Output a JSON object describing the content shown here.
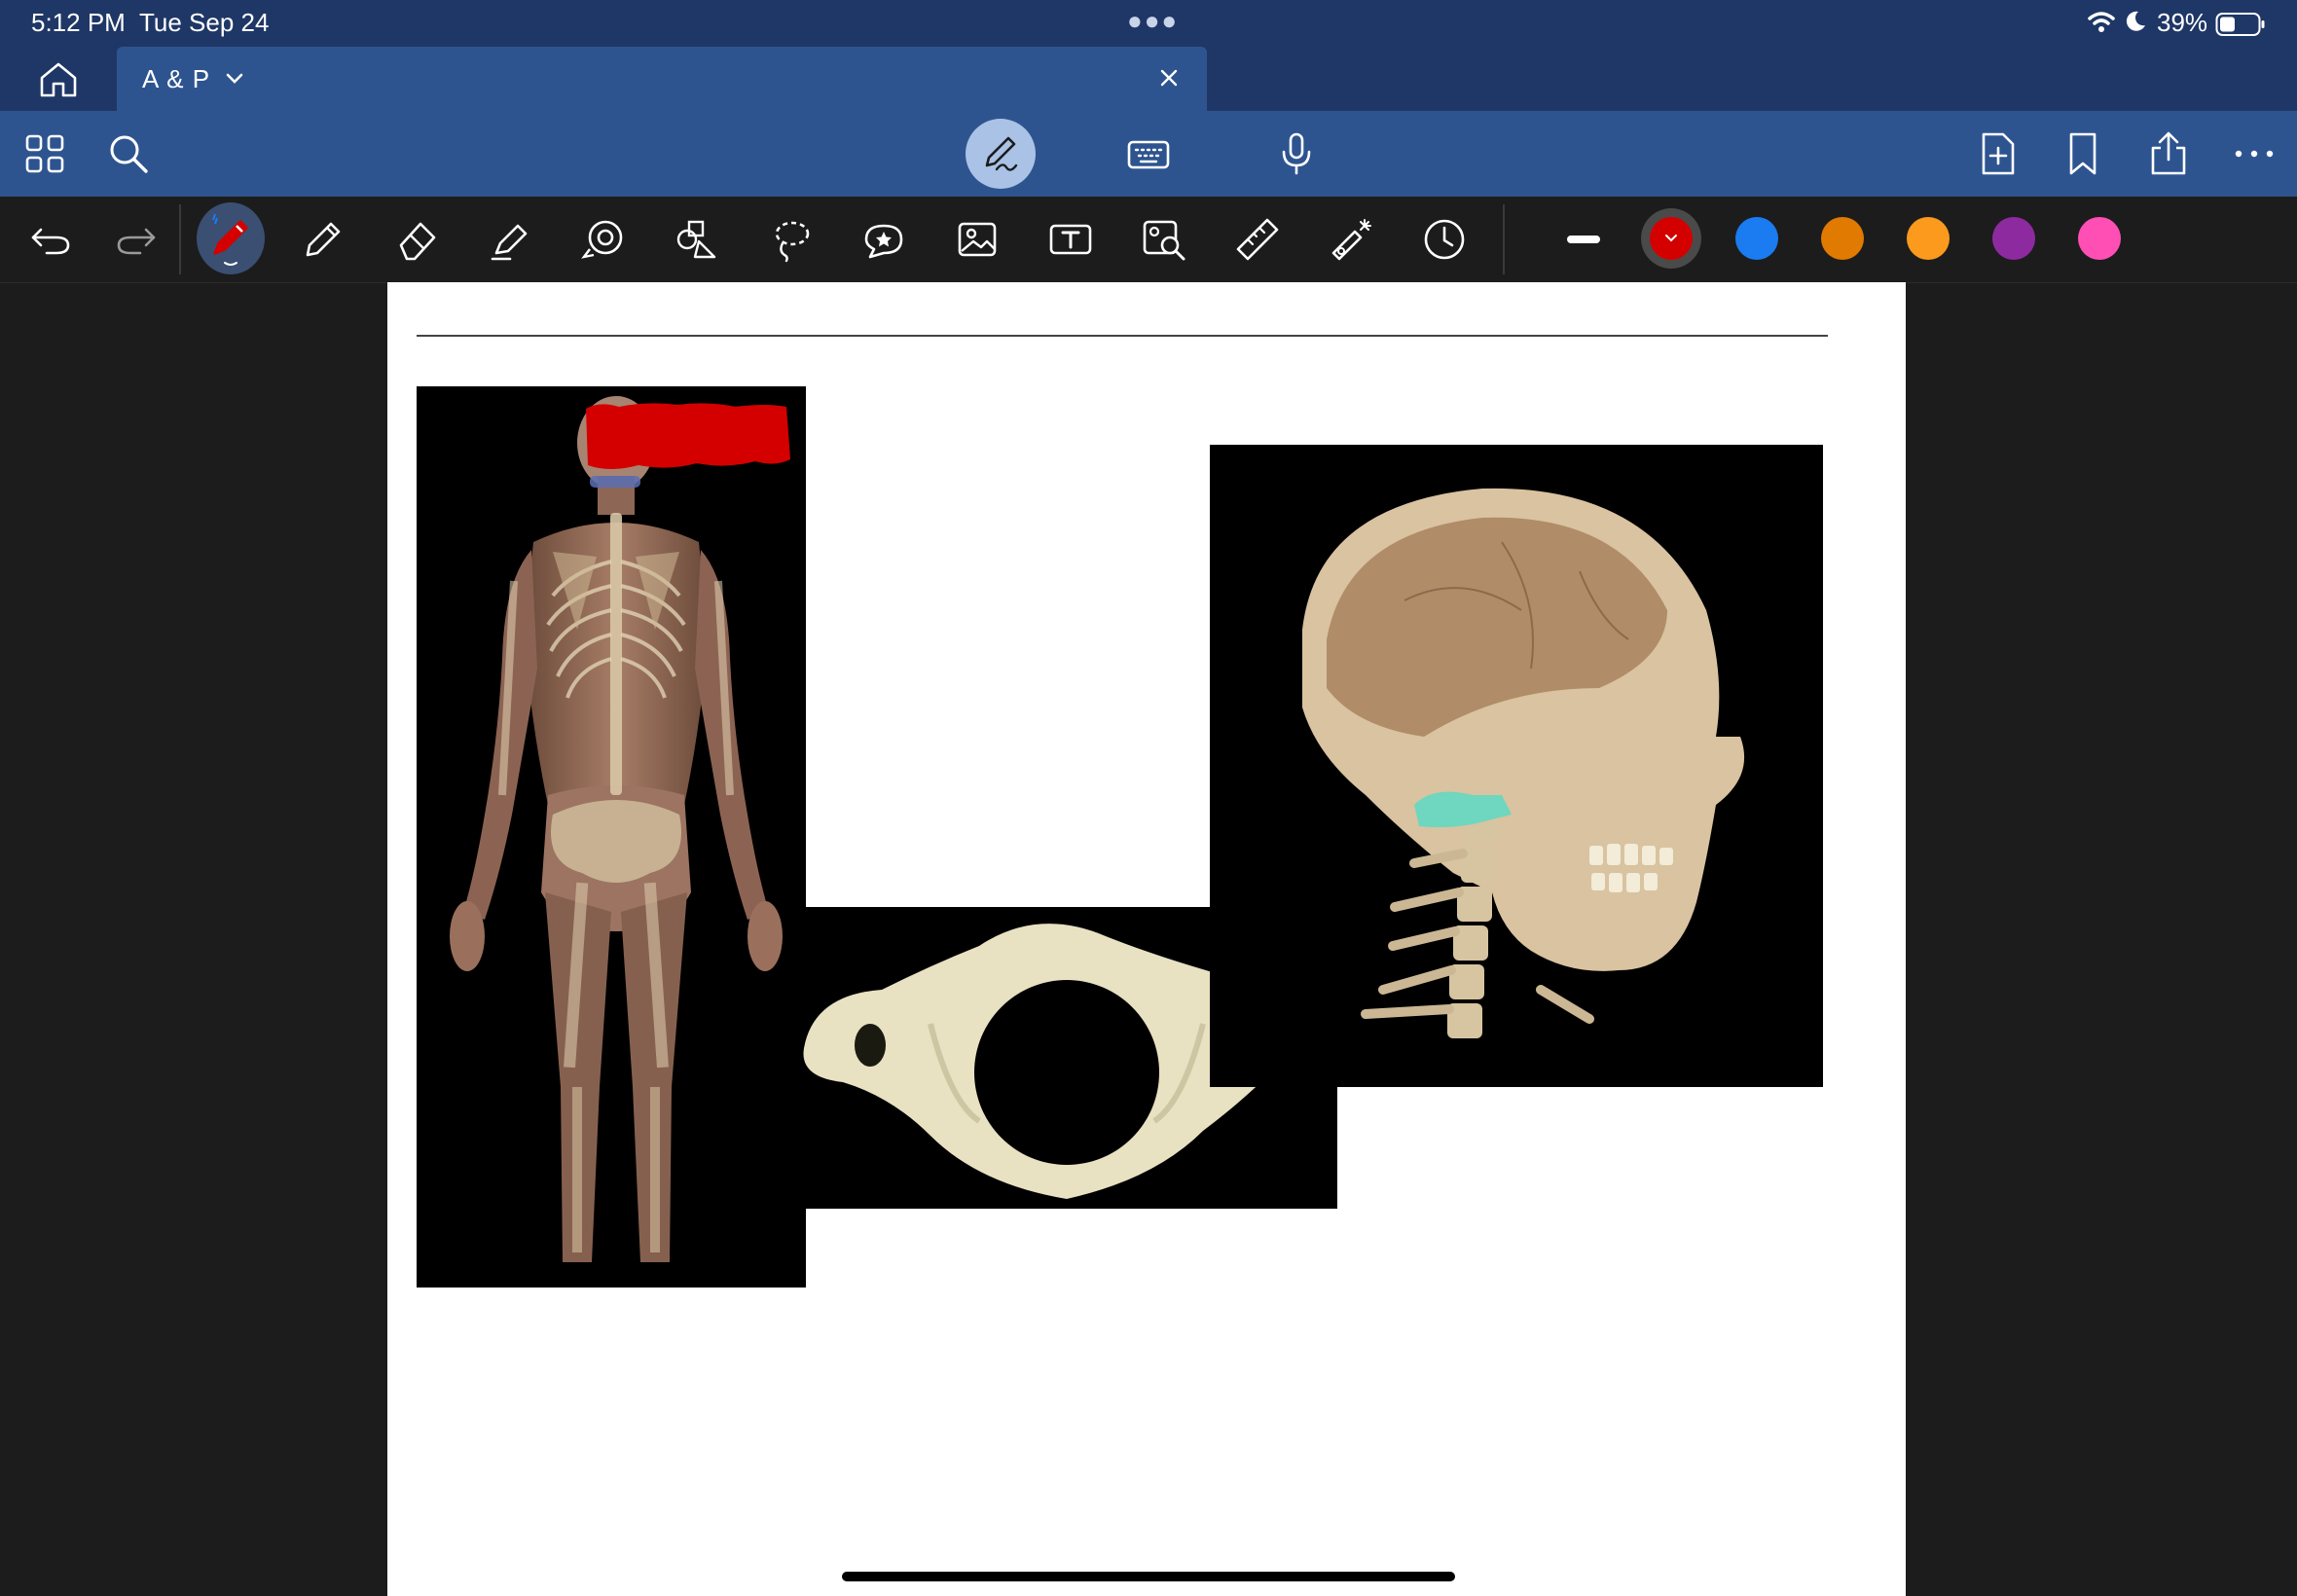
{
  "status_bar": {
    "time": "5:12 PM",
    "date": "Tue Sep 24",
    "battery": "39%"
  },
  "tab": {
    "title": "A & P"
  },
  "main_toolbar": {
    "left_icons": [
      "grid-icon",
      "search-icon"
    ],
    "center_icons": [
      "pen-mode-icon",
      "keyboard-icon",
      "microphone-icon"
    ],
    "right_icons": [
      "add-page-icon",
      "bookmark-icon",
      "share-icon",
      "more-icon"
    ]
  },
  "pen_toolbar": {
    "tools": [
      "undo",
      "redo",
      "pen",
      "pencil",
      "eraser",
      "highlighter",
      "shapes",
      "elements",
      "lasso",
      "stickers",
      "image",
      "text",
      "image-search",
      "ruler",
      "laser-pointer",
      "history"
    ],
    "active_tool": "pen",
    "stroke_width": "thick",
    "colors": [
      "#d40000",
      "#1a7cf0",
      "#e07a00",
      "#fb9a1c",
      "#8e2aa0",
      "#ff4fb5"
    ],
    "selected_color": "#d40000"
  },
  "canvas": {
    "images": [
      "skeleton-posterior-view",
      "cervical-vertebra-atlas",
      "skull-sagittal-section"
    ],
    "annotation_color": "#d40000"
  }
}
